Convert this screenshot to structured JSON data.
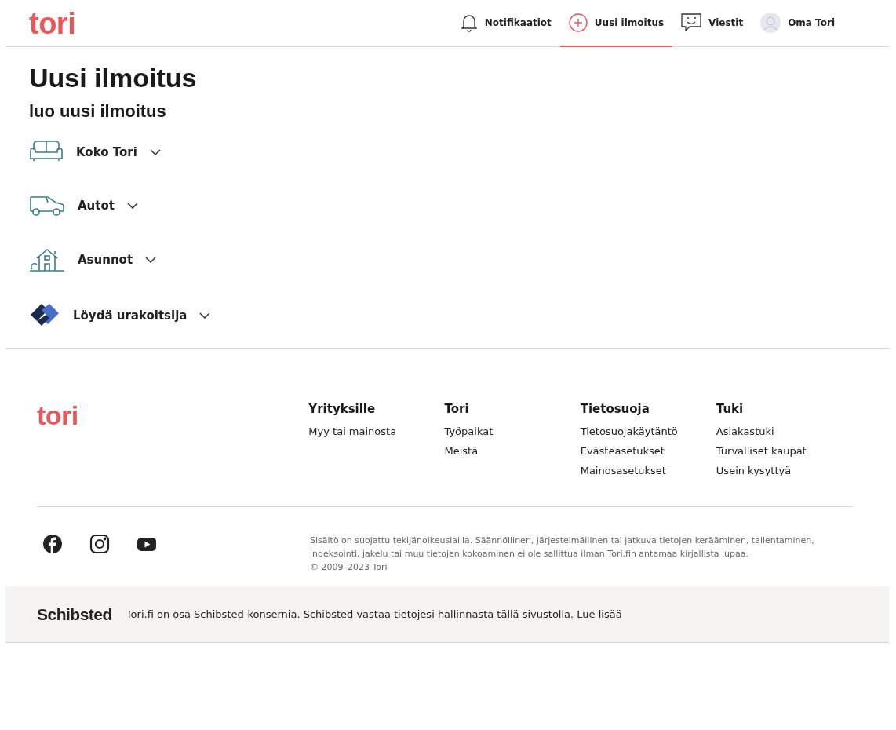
{
  "header": {
    "logo": "tori",
    "nav": [
      {
        "kind": "bell",
        "label": "Notifikaatiot",
        "selected": false
      },
      {
        "kind": "plus",
        "label": "Uusi ilmoitus",
        "selected": true
      },
      {
        "kind": "chat",
        "label": "Viestit",
        "selected": false
      },
      {
        "kind": "avatar",
        "label": "Oma Tori",
        "selected": false
      }
    ]
  },
  "page": {
    "title": "Uusi ilmoitus",
    "subtitle": "luo uusi ilmoitus",
    "categories": [
      {
        "kind": "sofa",
        "label": "Koko Tori",
        "expanded": false
      },
      {
        "kind": "car",
        "label": "Autot",
        "expanded": false
      },
      {
        "kind": "house",
        "label": "Asunnot",
        "expanded": false
      },
      {
        "kind": "handshake",
        "label": "Löydä urakoitsija",
        "expanded": false
      }
    ]
  },
  "footer": {
    "logo": "tori",
    "columns": [
      {
        "title": "Yrityksille",
        "links": [
          "Myy tai mainosta"
        ]
      },
      {
        "title": "Tori",
        "links": [
          "Työpaikat",
          "Meistä"
        ]
      },
      {
        "title": "Tietosuoja",
        "links": [
          "Tietosuojakäytäntö",
          "Evästeasetukset",
          "Mainosasetukset"
        ]
      },
      {
        "title": "Tuki",
        "links": [
          "Asiakastuki",
          "Turvalliset kaupat",
          "Usein kysyttyä"
        ]
      }
    ],
    "social": [
      {
        "kind": "facebook"
      },
      {
        "kind": "instagram"
      },
      {
        "kind": "youtube"
      }
    ],
    "legal": "Sisältö on suojattu tekijänoikeuslailla. Säännöllinen, järjestelmällinen tai jatkuva tietojen kerääminen, tallentaminen, indeksointi, jakelu tai muu tietojen kokoaminen ei ole sallittua ilman Tori.fin antamaa kirjallista lupaa.",
    "copyright": "© 2009–2023 Tori",
    "schibsted": {
      "logo": "Schibsted",
      "text": "Tori.fi on osa Schibsted-konsernia. Schibsted vastaa tietojesi hallinnasta tällä sivustolla.",
      "link": "Lue lisää"
    }
  }
}
